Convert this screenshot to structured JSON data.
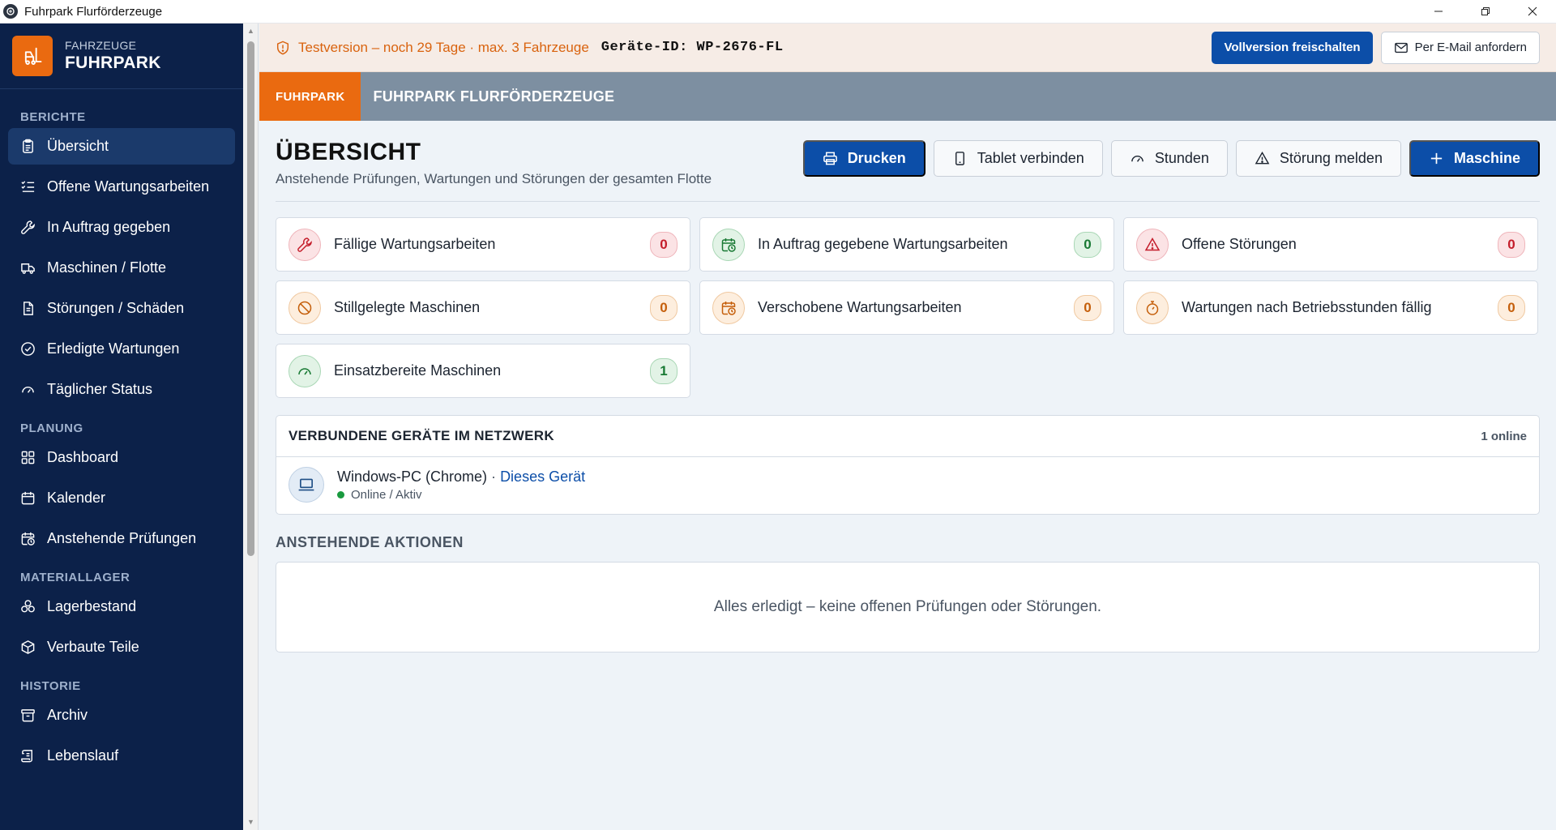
{
  "window": {
    "title": "Fuhrpark Flurförderzeuge"
  },
  "brand": {
    "subtitle": "FAHRZEUGE",
    "title": "FUHRPARK",
    "accent_color": "#ea6a10"
  },
  "sidebar": {
    "sections": [
      {
        "label": "BERICHTE",
        "items": [
          {
            "label": "Übersicht",
            "icon": "clipboard-icon",
            "active": true
          },
          {
            "label": "Offene Wartungsarbeiten",
            "icon": "list-checks-icon"
          },
          {
            "label": "In Auftrag gegeben",
            "icon": "wrench-icon"
          },
          {
            "label": "Maschinen / Flotte",
            "icon": "truck-icon"
          },
          {
            "label": "Störungen / Schäden",
            "icon": "document-icon"
          },
          {
            "label": "Erledigte Wartungen",
            "icon": "check-circle-icon"
          },
          {
            "label": "Täglicher Status",
            "icon": "gauge-icon"
          }
        ]
      },
      {
        "label": "PLANUNG",
        "items": [
          {
            "label": "Dashboard",
            "icon": "grid-icon"
          },
          {
            "label": "Kalender",
            "icon": "calendar-icon"
          },
          {
            "label": "Anstehende Prüfungen",
            "icon": "calendar-clock-icon"
          }
        ]
      },
      {
        "label": "MATERIALLAGER",
        "items": [
          {
            "label": "Lagerbestand",
            "icon": "boxes-icon"
          },
          {
            "label": "Verbaute Teile",
            "icon": "package-icon"
          }
        ]
      },
      {
        "label": "HISTORIE",
        "items": [
          {
            "label": "Archiv",
            "icon": "archive-icon"
          },
          {
            "label": "Lebenslauf",
            "icon": "scroll-icon"
          }
        ]
      }
    ]
  },
  "trial": {
    "text": "Testversion – noch 29 Tage · max. 3 Fahrzeuge",
    "device_id": "Geräte-ID: WP-2676-FL",
    "unlock_label": "Vollversion freischalten",
    "email_label": "Per E-Mail anfordern"
  },
  "tabbar": {
    "brand": "FUHRPARK",
    "title": "FUHRPARK FLURFÖRDERZEUGE"
  },
  "page": {
    "title": "ÜBERSICHT",
    "subtitle": "Anstehende Prüfungen, Wartungen und Störungen der gesamten Flotte",
    "actions": {
      "print": "Drucken",
      "tablet": "Tablet verbinden",
      "hours": "Stunden",
      "report": "Störung melden",
      "machine": "Maschine"
    }
  },
  "stats": [
    {
      "label": "Fällige Wartungsarbeiten",
      "value": "0",
      "tone": "red",
      "icon": "wrench-icon"
    },
    {
      "label": "In Auftrag gegebene Wartungsarbeiten",
      "value": "0",
      "tone": "green",
      "icon": "calendar-clock-icon"
    },
    {
      "label": "Offene Störungen",
      "value": "0",
      "tone": "red",
      "icon": "warning-icon"
    },
    {
      "label": "Stillgelegte Maschinen",
      "value": "0",
      "tone": "orange",
      "icon": "ban-icon"
    },
    {
      "label": "Verschobene Wartungsarbeiten",
      "value": "0",
      "tone": "orange",
      "icon": "calendar-clock-icon"
    },
    {
      "label": "Wartungen nach Betriebsstunden fällig",
      "value": "0",
      "tone": "orange",
      "icon": "stopwatch-icon"
    },
    {
      "label": "Einsatzbereite Maschinen",
      "value": "1",
      "tone": "green",
      "icon": "gauge-icon"
    }
  ],
  "network": {
    "title": "VERBUNDENE GERÄTE IM NETZWERK",
    "count": "1 online",
    "device": {
      "name": "Windows-PC (Chrome)",
      "separator": "·",
      "self": "Dieses Gerät",
      "status": "Online / Aktiv"
    }
  },
  "pending": {
    "title": "ANSTEHENDE AKTIONEN",
    "empty": "Alles erledigt – keine offenen Prüfungen oder Störungen."
  }
}
